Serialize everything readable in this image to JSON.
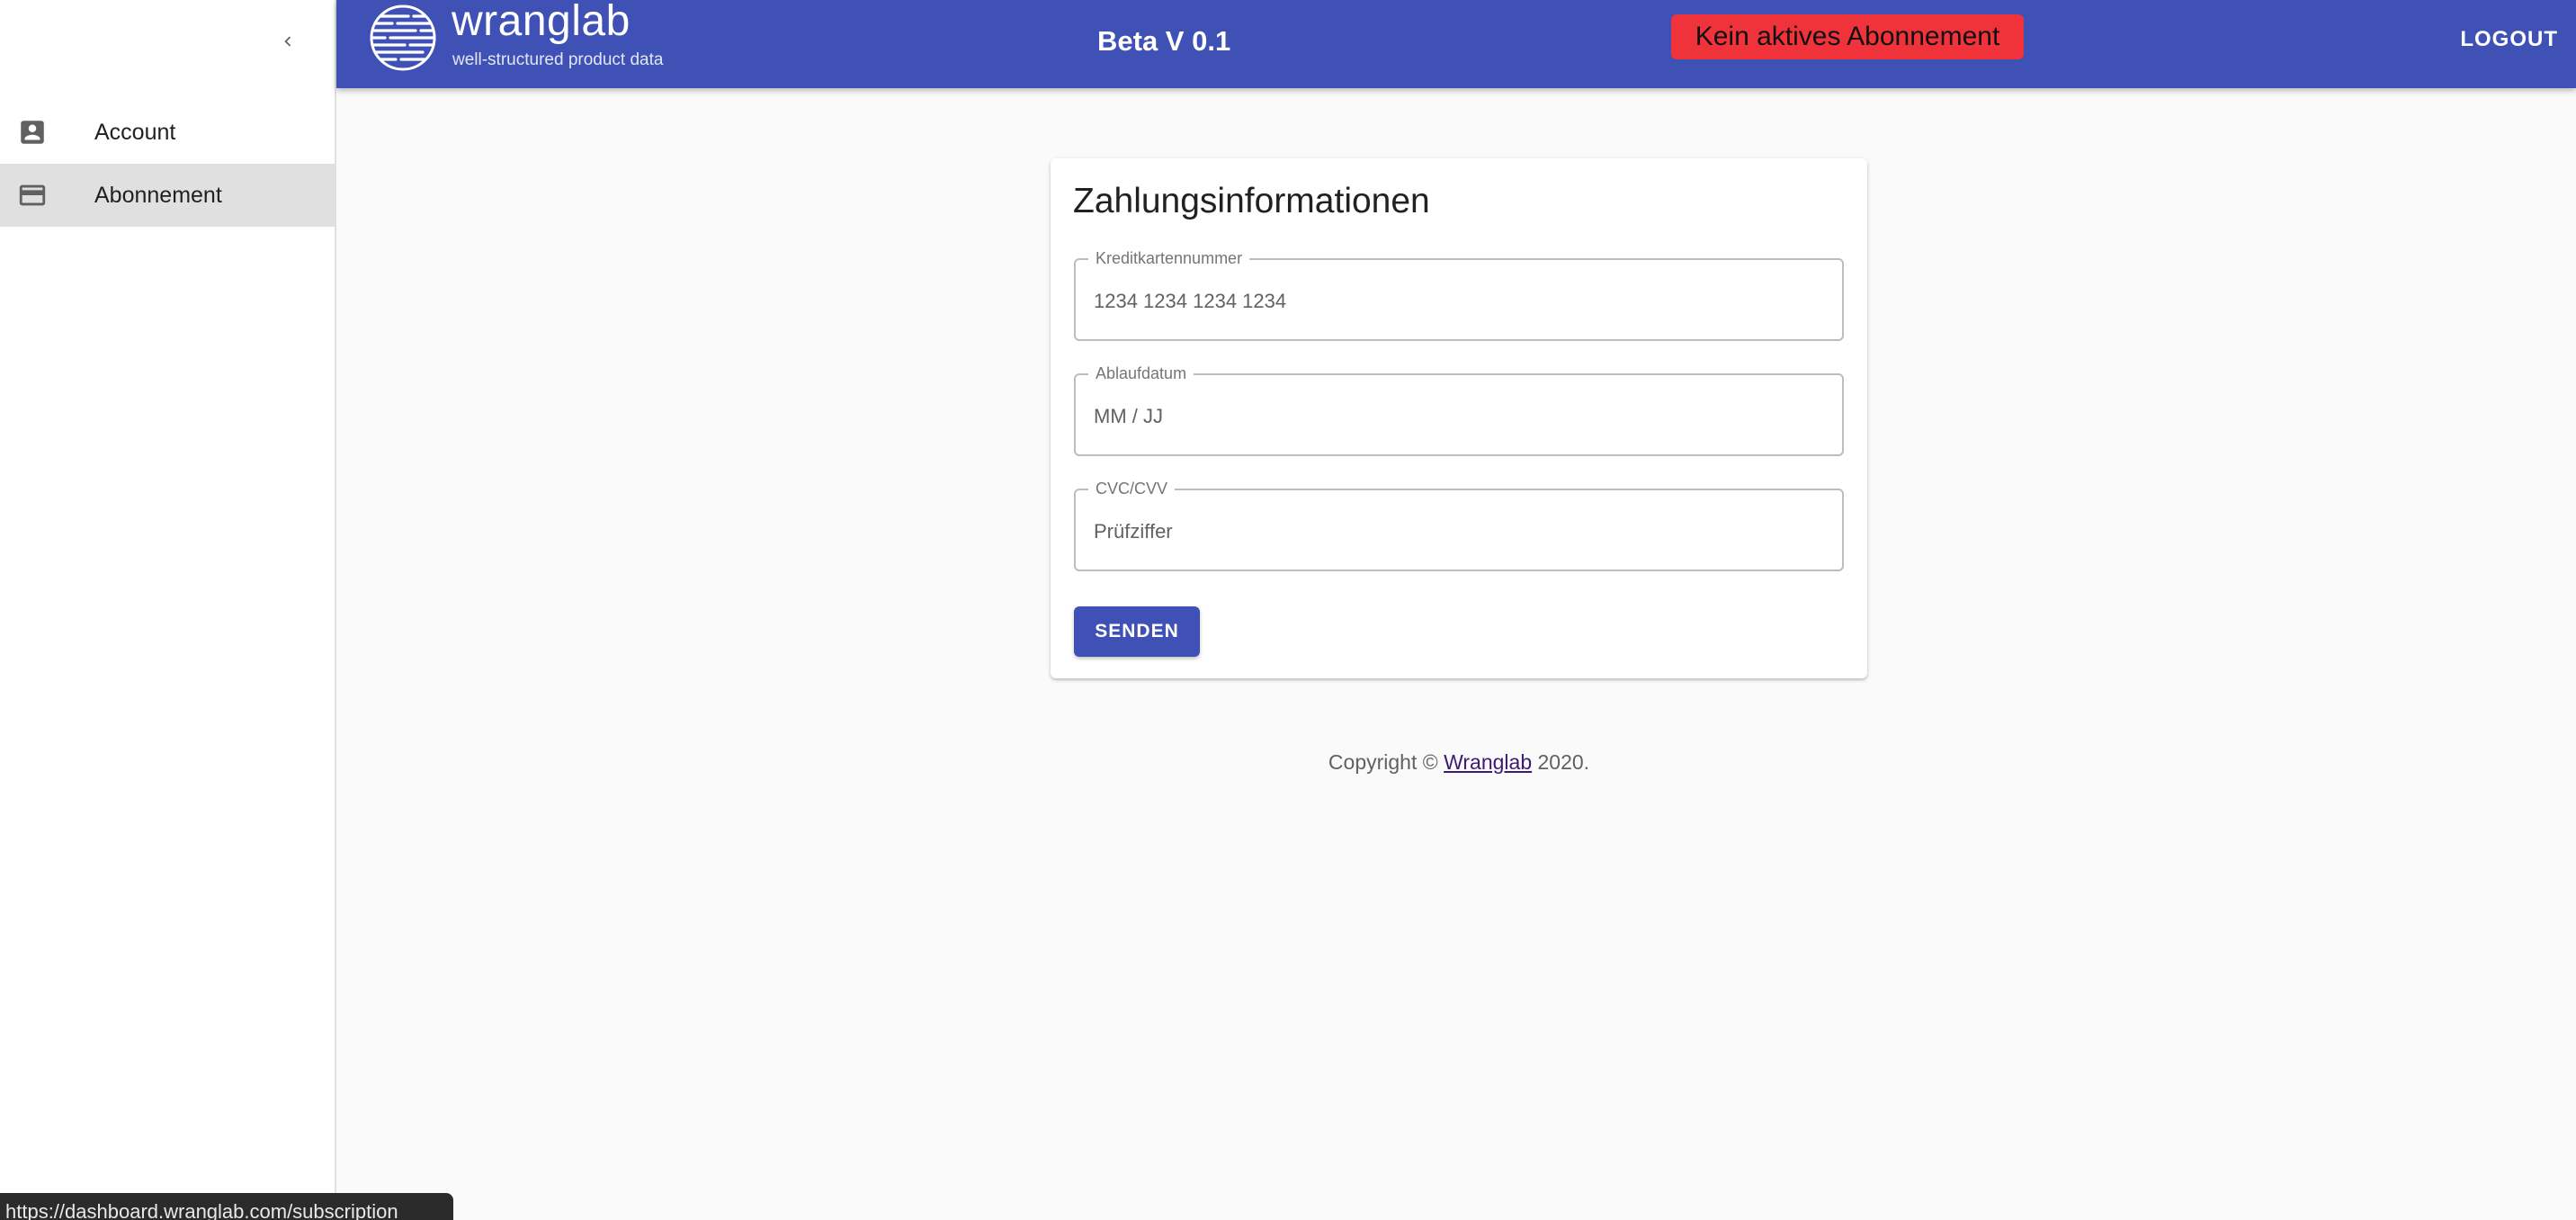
{
  "sidebar": {
    "collapse_icon": "chevron-left-icon",
    "items": [
      {
        "label": "Account",
        "icon": "account-box-icon",
        "active": false
      },
      {
        "label": "Abonnement",
        "icon": "credit-card-icon",
        "active": true
      }
    ]
  },
  "header": {
    "brand": "wranglab",
    "tagline": "well-structured product data",
    "version": "Beta V 0.1",
    "subscription_status": "Kein aktives Abonnement",
    "logout_label": "LOGOUT"
  },
  "payment": {
    "title": "Zahlungsinformationen",
    "fields": [
      {
        "label": "Kreditkartennummer",
        "placeholder": "1234 1234 1234 1234"
      },
      {
        "label": "Ablaufdatum",
        "placeholder": "MM / JJ"
      },
      {
        "label": "CVC/CVV",
        "placeholder": "Prüfziffer"
      }
    ],
    "submit_label": "SENDEN"
  },
  "footer": {
    "prefix": "Copyright © ",
    "link_text": "Wranglab",
    "suffix": " 2020."
  },
  "status_url": "https://dashboard.wranglab.com/subscription",
  "colors": {
    "primary": "#3f51b5",
    "badge_bg": "#f0323a",
    "active_nav_bg": "#e0e0e0"
  }
}
